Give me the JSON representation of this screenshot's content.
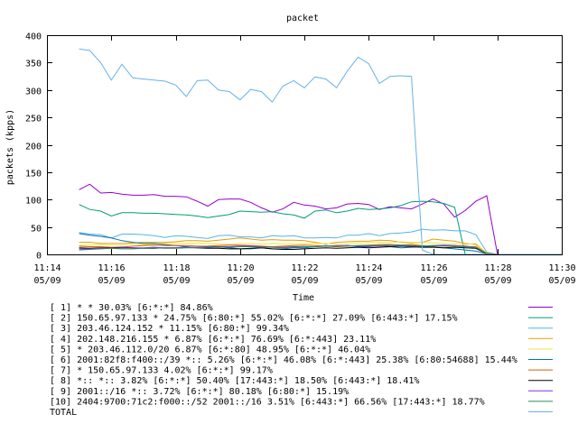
{
  "chart_data": {
    "type": "line",
    "title": "packet",
    "xlabel": "Time",
    "ylabel": "packets (kpps)",
    "ylim": [
      0,
      400
    ],
    "yticks": [
      0,
      50,
      100,
      150,
      200,
      250,
      300,
      350,
      400
    ],
    "xticks": [
      {
        "time": "11:14",
        "date": "05/09",
        "minute": 0
      },
      {
        "time": "11:16",
        "date": "05/09",
        "minute": 2
      },
      {
        "time": "11:18",
        "date": "05/09",
        "minute": 4
      },
      {
        "time": "11:20",
        "date": "05/09",
        "minute": 6
      },
      {
        "time": "11:22",
        "date": "05/09",
        "minute": 8
      },
      {
        "time": "11:24",
        "date": "05/09",
        "minute": 10
      },
      {
        "time": "11:26",
        "date": "05/09",
        "minute": 12
      },
      {
        "time": "11:28",
        "date": "05/09",
        "minute": 14
      },
      {
        "time": "11:30",
        "date": "05/09",
        "minute": 16
      }
    ],
    "x": [
      1,
      1.33,
      1.67,
      2,
      2.33,
      2.67,
      3,
      3.33,
      3.67,
      4,
      4.33,
      4.67,
      5,
      5.33,
      5.67,
      6,
      6.33,
      6.67,
      7,
      7.33,
      7.67,
      8,
      8.33,
      8.67,
      9,
      9.33,
      9.67,
      10,
      10.33,
      10.67,
      11,
      11.33,
      11.67,
      12,
      12.33,
      12.67,
      13,
      13.33,
      13.67,
      14,
      14.33,
      14.67,
      15,
      15.33,
      15.67,
      16
    ],
    "legend_position": "bottom",
    "series": [
      {
        "name": "[ 1] * * 30.03%  [6:*:*] 84.86%",
        "color": "#9400d3",
        "values": [
          118,
          128,
          112,
          113,
          110,
          108,
          108,
          109,
          106,
          106,
          105,
          97,
          88,
          100,
          101,
          101,
          95,
          85,
          77,
          83,
          95,
          90,
          88,
          83,
          85,
          92,
          93,
          91,
          82,
          87,
          85,
          83,
          92,
          101,
          92,
          68,
          80,
          97,
          107,
          0,
          0,
          0,
          0,
          0,
          0,
          0
        ]
      },
      {
        "name": "[ 2] 150.65.97.133 * 24.75%  [6:80:*] 55.02% [6:*:*] 27.09% [6:443:*] 17.15%",
        "color": "#009e73",
        "values": [
          91,
          82,
          79,
          70,
          76,
          76,
          75,
          75,
          74,
          73,
          72,
          70,
          67,
          70,
          73,
          79,
          78,
          77,
          78,
          74,
          72,
          66,
          79,
          81,
          76,
          79,
          84,
          82,
          83,
          85,
          89,
          96,
          97,
          96,
          93,
          86,
          0,
          0,
          0,
          0,
          0,
          0,
          0,
          0,
          0,
          0
        ]
      },
      {
        "name": "[ 3] 203.46.124.152 * 11.15%  [6:80:*] 99.34%",
        "color": "#56b4e9",
        "values": [
          40,
          37,
          36,
          30,
          37,
          37,
          36,
          34,
          31,
          34,
          33,
          31,
          29,
          34,
          35,
          32,
          32,
          30,
          34,
          33,
          34,
          30,
          30,
          31,
          30,
          35,
          35,
          38,
          34,
          38,
          39,
          41,
          46,
          44,
          45,
          43,
          43,
          36,
          4,
          0,
          0,
          0,
          0,
          0,
          0,
          0
        ]
      },
      {
        "name": "[ 4] 202.148.216.155 * 6.87%  [6:*:*] 76.69% [6:*:443] 23.11%",
        "color": "#e69f00",
        "values": [
          22,
          22,
          20,
          20,
          20,
          21,
          22,
          22,
          22,
          23,
          25,
          25,
          24,
          26,
          28,
          30,
          28,
          26,
          27,
          26,
          26,
          25,
          22,
          19,
          22,
          23,
          24,
          24,
          26,
          25,
          22,
          21,
          22,
          28,
          26,
          24,
          20,
          18,
          2,
          0,
          0,
          0,
          0,
          0,
          0,
          0
        ]
      },
      {
        "name": "[ 5] * 203.46.112.0/20 6.87%  [6:*:80] 48.95% [6:*:*] 46.04%",
        "color": "#f0e442",
        "values": [
          16,
          17,
          18,
          17,
          17,
          19,
          18,
          19,
          20,
          20,
          20,
          21,
          20,
          19,
          18,
          20,
          20,
          19,
          20,
          19,
          19,
          20,
          20,
          20,
          19,
          19,
          21,
          21,
          22,
          21,
          23,
          22,
          22,
          21,
          20,
          19,
          18,
          20,
          2,
          0,
          0,
          0,
          0,
          0,
          0,
          0
        ]
      },
      {
        "name": "[ 6] 2001:82f8:f400::/39 *:: 5.26%  [6:*:*] 46.08% [6:*:443] 25.38% [6:80:54688] 15.44%",
        "color": "#0072b2",
        "values": [
          38,
          35,
          33,
          30,
          25,
          22,
          20,
          20,
          18,
          16,
          14,
          12,
          12,
          14,
          12,
          10,
          10,
          12,
          10,
          10,
          12,
          12,
          14,
          16,
          14,
          16,
          14,
          14,
          16,
          14,
          12,
          13,
          14,
          14,
          12,
          10,
          8,
          6,
          1,
          0,
          0,
          0,
          0,
          0,
          0,
          0
        ]
      },
      {
        "name": "[ 7] * 150.65.97.133 4.02%  [6:*:*] 99.17%",
        "color": "#d55e00",
        "values": [
          15,
          14,
          14,
          13,
          13,
          15,
          16,
          17,
          16,
          16,
          16,
          15,
          15,
          16,
          17,
          17,
          16,
          15,
          14,
          15,
          16,
          17,
          16,
          15,
          14,
          15,
          16,
          17,
          18,
          18,
          17,
          18,
          16,
          15,
          16,
          15,
          14,
          14,
          2,
          0,
          0,
          0,
          0,
          0,
          0,
          0
        ]
      },
      {
        "name": "[ 8] *:: *:: 3.82%  [6:*:*] 50.40% [17:443:*] 18.50% [6:443:*] 18.41%",
        "color": "#000000",
        "values": [
          12,
          11,
          12,
          12,
          13,
          12,
          11,
          11,
          12,
          12,
          13,
          12,
          11,
          11,
          10,
          10,
          11,
          12,
          10,
          9,
          9,
          10,
          11,
          12,
          11,
          12,
          13,
          12,
          13,
          14,
          15,
          14,
          13,
          13,
          12,
          13,
          12,
          11,
          1,
          0,
          0,
          0,
          0,
          0,
          0,
          0
        ]
      },
      {
        "name": "[ 9] 2001::/16 *:: 3.72%  [6:*:*] 80.18% [6:80:*] 15.19%",
        "color": "#8a2be2",
        "values": [
          10,
          10,
          11,
          11,
          12,
          12,
          12,
          13,
          12,
          12,
          13,
          13,
          14,
          14,
          14,
          15,
          15,
          14,
          13,
          13,
          14,
          14,
          14,
          15,
          16,
          16,
          15,
          15,
          15,
          16,
          16,
          15,
          15,
          16,
          17,
          16,
          15,
          13,
          1,
          0,
          0,
          0,
          0,
          0,
          0,
          0
        ]
      },
      {
        "name": "[10] 2404:9700:71c2:f000::/52 2001::/16 3.51%  [6:443:*] 66.56% [17:443:*] 18.77%",
        "color": "#2e8b57",
        "values": [
          8,
          9,
          10,
          11,
          10,
          10,
          11,
          12,
          11,
          11,
          12,
          12,
          13,
          13,
          13,
          14,
          14,
          13,
          13,
          12,
          13,
          14,
          14,
          15,
          15,
          15,
          16,
          16,
          16,
          17,
          17,
          16,
          15,
          16,
          15,
          15,
          14,
          13,
          1,
          0,
          0,
          0,
          0,
          0,
          0,
          0
        ]
      },
      {
        "name": "TOTAL",
        "color": "#66b2e8",
        "values": [
          375,
          372,
          350,
          318,
          347,
          322,
          320,
          318,
          316,
          309,
          288,
          317,
          318,
          300,
          297,
          282,
          301,
          297,
          278,
          307,
          317,
          304,
          324,
          320,
          304,
          334,
          360,
          348,
          312,
          325,
          326,
          325,
          8,
          0,
          0,
          0,
          0,
          0,
          0,
          0,
          0,
          0,
          0,
          0,
          0,
          0
        ]
      }
    ]
  }
}
